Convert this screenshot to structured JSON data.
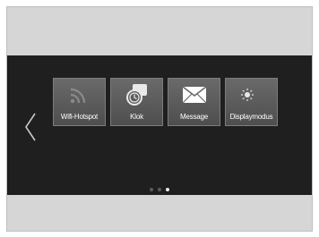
{
  "tiles": [
    {
      "label": "Wifi-Hotspot",
      "icon": "wifi-icon"
    },
    {
      "label": "Klok",
      "icon": "clock-icon"
    },
    {
      "label": "Message",
      "icon": "envelope-icon"
    },
    {
      "label": "Displaymodus",
      "icon": "sun-moon-icon"
    }
  ],
  "pager": {
    "page_count": 3,
    "active_page": 3
  },
  "colors": {
    "screen": "#1f1f1f",
    "tile": "#5c5c5c",
    "frame": "#d6d6d6"
  }
}
